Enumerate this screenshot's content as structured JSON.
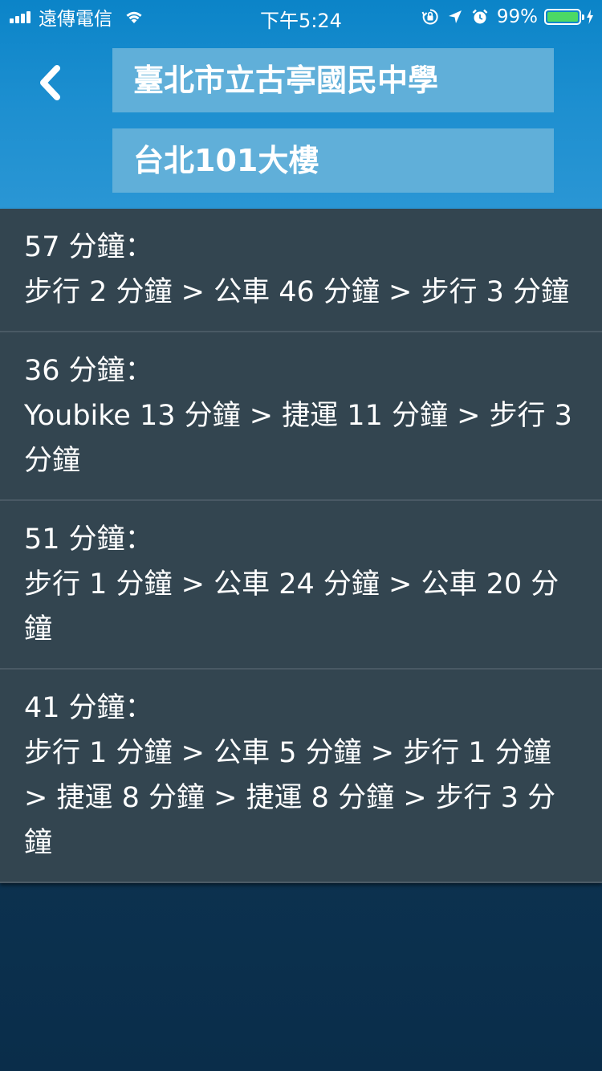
{
  "status_bar": {
    "carrier": "遠傳電信",
    "time": "下午5:24",
    "battery_percent": "99%",
    "battery_level": 0.99,
    "battery_color": "#4cd964",
    "icons": [
      "signal-icon",
      "wifi-icon",
      "orientation-lock-icon",
      "location-arrow-icon",
      "alarm-icon",
      "battery-icon",
      "charging-bolt-icon"
    ]
  },
  "header": {
    "back_icon": "chevron-left-icon",
    "origin": "臺北市立古亭國民中學",
    "destination": "台北101大樓"
  },
  "routes": [
    {
      "total": "57 分鐘：",
      "steps": "步行 2 分鐘 > 公車 46 分鐘 > 步行 3 分鐘"
    },
    {
      "total": "36 分鐘：",
      "steps": "Youbike 13 分鐘 > 捷運 11 分鐘 > 步行 3 分鐘"
    },
    {
      "total": "51 分鐘：",
      "steps": "步行 1 分鐘 > 公車 24 分鐘 > 公車 20 分鐘"
    },
    {
      "total": "41 分鐘：",
      "steps": "步行 1 分鐘 > 公車 5 分鐘 > 步行 1 分鐘 > 捷運 8 分鐘 > 捷運 8 分鐘 > 步行 3 分鐘"
    }
  ],
  "colors": {
    "header": "#1d8fd0",
    "field": "#60afd9",
    "route_bg": "#334550",
    "page_bg": "#0d3553"
  }
}
